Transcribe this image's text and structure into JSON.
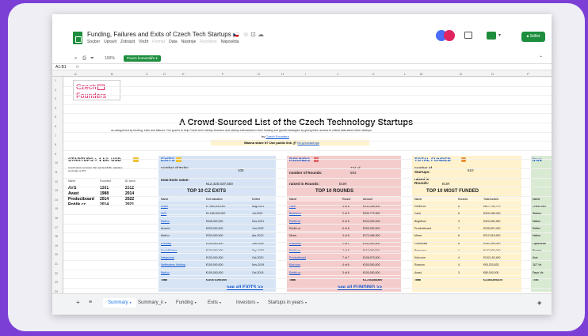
{
  "window": {
    "title": "Funding, Failures and Exits of Czech Tech Startups",
    "title_flag": "🇨🇿",
    "menu": [
      "Soubor",
      "Upravit",
      "Zobrazit",
      "Vložit",
      "Formát",
      "Data",
      "Nástroje",
      "Rozšíření",
      "Nápověda"
    ],
    "share_label": "Sdílet"
  },
  "toolbar": {
    "zoom": "100%",
    "filter_label": "Pouze komentáře"
  },
  "formula": {
    "cell_ref": "A1:B1"
  },
  "columns": [
    "A",
    "B",
    "C",
    "D",
    "E",
    "F",
    "G",
    "H",
    "I",
    "J",
    "K",
    "L",
    "M",
    "N",
    "O",
    "P"
  ],
  "header": {
    "logo_line1": "Czech",
    "logo_line2": "Founders",
    "title": "A Crowd-Sourced List of the Czech Technology Startups",
    "subtitle": "as categorized by funding, exits and failures. Our goal is to help Czech tech startup founders and startup enthusiasts in their funding and growth strategies by giving them access to critical data about other startups.",
    "by_label": "by",
    "by_link": "Czech Founders",
    "share_prompt": "Wanna share it? Use public link",
    "share_link": "bit.ly/czstartups"
  },
  "unicorns": {
    "title": "STARTUPS > 1 bil. USD",
    "desc": "A technology company that reached $1B+ valuation as private or IPO",
    "columns": [
      "Name",
      "Founded",
      "$1 since"
    ],
    "rows": [
      [
        "AVG",
        "1991",
        "2012"
      ],
      [
        "Avast",
        "1988",
        "2014"
      ],
      [
        "Productboard",
        "2014",
        "2022"
      ],
      [
        "Rohlik.cz",
        "2014",
        "2021"
      ]
    ]
  },
  "exits": {
    "title": "EXITS",
    "num_label": "number of Exits:",
    "num_value": "105",
    "total_label": "total Exits value:",
    "total_value": "€12,420,037,500",
    "table_title": "TOP 10 CZ EXITS",
    "columns": [
      "Name",
      "Exit valuation",
      "Exited"
    ],
    "rows": [
      [
        "Avast",
        "€7,980,000,000",
        "Aug-2021"
      ],
      [
        "AVG",
        "€1,180,000,000",
        "Jul-2012"
      ],
      [
        "Mall.cz",
        "€946,000,000",
        "Nov-2021"
      ],
      [
        "Around",
        "€230,000,000",
        "Jun-2022"
      ],
      [
        "Mall.cz",
        "€230,000,000",
        "Apr-2012"
      ],
      [
        "Exelusio",
        "€130,000,000",
        "Jun-2016"
      ],
      [
        "SocialBakers",
        "€130,000,000",
        "Sep-2020"
      ],
      [
        "Integromat",
        "€130,000,000",
        "Oct-2020"
      ],
      [
        "Netfleaders Holding",
        "€100,000,000",
        "Nov-2019"
      ],
      [
        "Mall.cz",
        "€100,000,000",
        "Oct-2015"
      ]
    ],
    "total_row": [
      "Total",
      "€10,973,000,000",
      ""
    ],
    "see_all": "see all EXITS >>"
  },
  "rounds": {
    "title": "ROUNDS",
    "num_label": "number of Rounds:",
    "num_value_top": "724 of",
    "num_value": "593",
    "raised_label": "raised in Rounds:",
    "raised_value": "EUR",
    "table_title": "TOP 10 ROUNDS",
    "columns": [
      "Name",
      "Round",
      "Amount"
    ],
    "rows": [
      [
        "Carix",
        "4 of 8",
        "€232,336,000"
      ],
      [
        "Brightlum",
        "2 of 3",
        "€230,773,300"
      ],
      [
        "Rohlik.cz",
        "5 of 6",
        "€220,000,000"
      ],
      [
        "Rohlik.cz",
        "6 of 6",
        "€200,000,000"
      ],
      [
        "Mews",
        "4 of 6",
        "€172,466,300"
      ],
      [
        "Rossumo",
        "1 of 1",
        "€142,000,000"
      ],
      [
        "Rohlik.cz",
        "7 of 8",
        "€110,000,000"
      ],
      [
        "Productboard",
        "7 of 7",
        "€108,973,000"
      ],
      [
        "Kiwi.com",
        "4 of 6",
        "€100,000,000"
      ],
      [
        "Rohlik.cz",
        "3 of 6",
        "€100,000,000"
      ]
    ],
    "total_row": [
      "Total",
      "",
      "€1,734,548,600"
    ],
    "see_all": "see all FUNDING >>"
  },
  "funded": {
    "title": "TOTAL FUNDED",
    "num_label": "number of Startups:",
    "num_value": "610",
    "raised_label": "raised in Rounds:",
    "raised_value": "EUR",
    "table_title": "TOP 10 MOST FUNDED",
    "columns": [
      "Name",
      "Rounds",
      "Total funded"
    ],
    "rows": [
      [
        "Rohlik.cz",
        "8",
        "€617,700,770"
      ],
      [
        "Carix",
        "6",
        "€329,496,000"
      ],
      [
        "Brightlum",
        "3",
        "€323,494,300"
      ],
      [
        "Productboard",
        "7",
        "€235,507,000"
      ],
      [
        "Mews",
        "6",
        "€212,518,900"
      ],
      [
        "GoodData",
        "8",
        "€182,490,000"
      ],
      [
        "Rossumo",
        "1",
        "€142,000,000"
      ],
      [
        "Kiwi.com",
        "4",
        "€132,192,490"
      ],
      [
        "Rossum",
        "4",
        "€93,333,833"
      ],
      [
        "Avast",
        "3",
        "€80,000,000"
      ]
    ],
    "total_row": [
      "Total",
      "",
      "€2,354,505,870"
    ]
  },
  "invest": {
    "title": "Inve",
    "label": "Name",
    "rows": [
      "Credo Ven.",
      "Startup",
      "Nation",
      "Reflex",
      "Nation",
      "Lighthouse",
      "Roosm",
      "Kiwi",
      "J&T Ve.",
      "Depo Ve.",
      "Total"
    ]
  },
  "row_numbers": [
    "1",
    "2",
    "3",
    "4",
    "5",
    "6",
    "7",
    "8",
    "9",
    "10",
    "11",
    "12",
    "13",
    "14",
    "15",
    "16",
    "17",
    "18",
    "19",
    "20",
    "21",
    "22",
    "23",
    "24",
    "25"
  ],
  "tabs": [
    "Summary",
    "Summary_ii",
    "Funding",
    "Exits",
    "Investors",
    "Startups in years"
  ],
  "colors": {
    "accent_green": "#1e8e3e",
    "exits_bg": "#d6e4f5",
    "rounds_bg": "#f4cccc",
    "funded_bg": "#fff2cc",
    "invest_bg": "#d9ead3",
    "link_blue": "#1155cc",
    "brand_red": "#e0245e"
  }
}
